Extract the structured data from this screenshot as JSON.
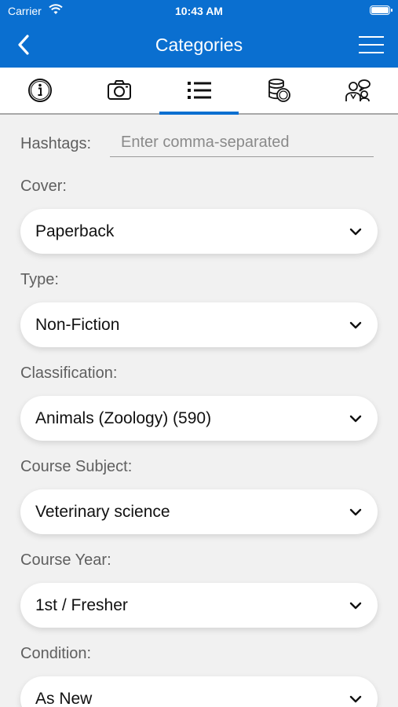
{
  "status_bar": {
    "carrier": "Carrier",
    "time": "10:43 AM"
  },
  "nav": {
    "title": "Categories",
    "back_icon": "chevron-left-icon",
    "menu_icon": "hamburger-menu-icon"
  },
  "tabs": [
    {
      "name": "info",
      "icon": "info-icon",
      "active": false
    },
    {
      "name": "photos",
      "icon": "camera-icon",
      "active": false
    },
    {
      "name": "categories",
      "icon": "list-icon",
      "active": true
    },
    {
      "name": "pricing",
      "icon": "coins-icon",
      "active": false
    },
    {
      "name": "contacts",
      "icon": "people-icon",
      "active": false
    }
  ],
  "form": {
    "hashtags_label": "Hashtags:",
    "hashtags_placeholder": "Enter comma-separated",
    "hashtags_value": "",
    "fields": [
      {
        "label": "Cover:",
        "value": "Paperback"
      },
      {
        "label": "Type:",
        "value": "Non-Fiction"
      },
      {
        "label": "Classification:",
        "value": "Animals (Zoology) (590)"
      },
      {
        "label": "Course Subject:",
        "value": "Veterinary science"
      },
      {
        "label": "Course Year:",
        "value": "1st / Fresher"
      },
      {
        "label": "Condition:",
        "value": "As New"
      }
    ]
  },
  "colors": {
    "brand": "#0a6fd0",
    "background": "#f1f1f1"
  }
}
